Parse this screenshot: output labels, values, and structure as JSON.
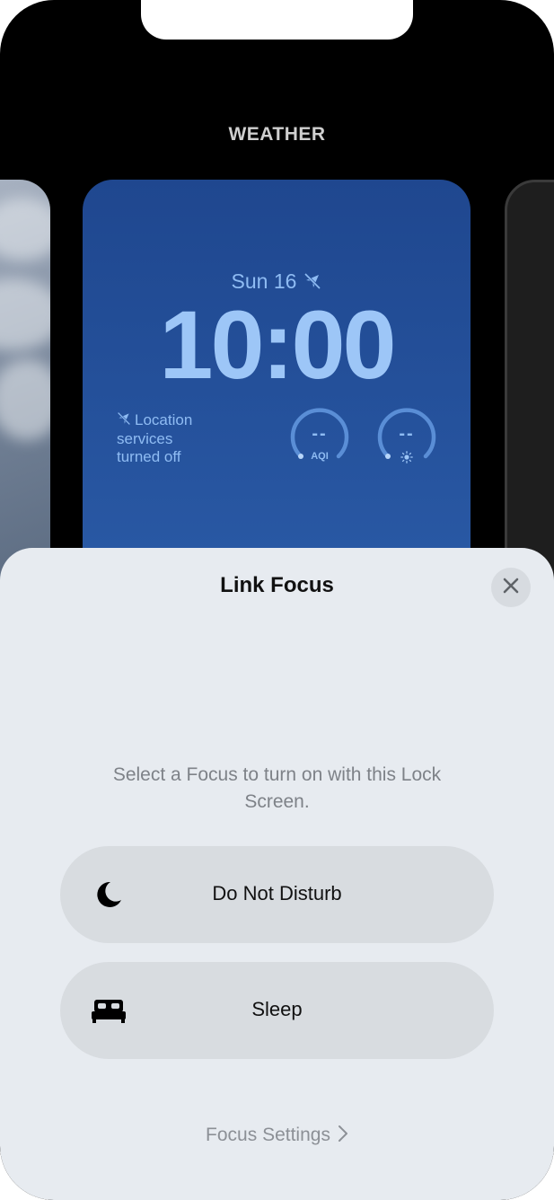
{
  "header": {
    "section_label": "WEATHER"
  },
  "lock_screen_preview": {
    "date": "Sun 16",
    "time": "10:00",
    "location_line1": "Location",
    "location_line2": "services",
    "location_line3": "turned off",
    "gauge_aqi_value": "--",
    "gauge_aqi_label": "AQI",
    "gauge_uv_value": "--"
  },
  "sheet": {
    "title": "Link Focus",
    "prompt": "Select a Focus to turn on with this Lock Screen.",
    "options": [
      {
        "label": "Do Not Disturb",
        "icon": "moon-icon"
      },
      {
        "label": "Sleep",
        "icon": "bed-icon"
      }
    ],
    "settings_link": "Focus Settings"
  },
  "colors": {
    "card_blue": "#24509a",
    "accent_light_blue": "#9dc6f7",
    "sheet_bg": "#e7ebf0",
    "button_bg": "#d8dce0"
  }
}
